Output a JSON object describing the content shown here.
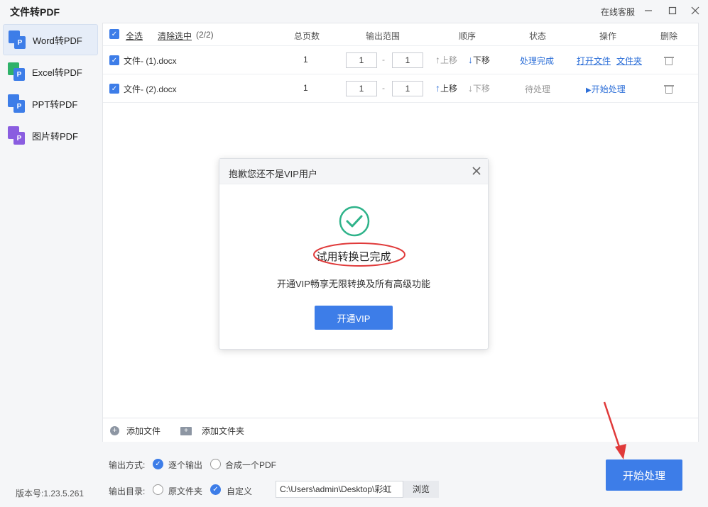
{
  "app": {
    "title": "文件转PDF",
    "online_service": "在线客服",
    "version": "版本号:1.23.5.261"
  },
  "sidebar": {
    "items": [
      {
        "label": "Word转PDF",
        "icon": "word-to-pdf-icon",
        "color": "#3d7de8",
        "active": true
      },
      {
        "label": "Excel转PDF",
        "icon": "excel-to-pdf-icon",
        "color": "#2fb26a",
        "active": false
      },
      {
        "label": "PPT转PDF",
        "icon": "ppt-to-pdf-icon",
        "color": "#3d7de8",
        "active": false
      },
      {
        "label": "图片转PDF",
        "icon": "image-to-pdf-icon",
        "color": "#8a5de0",
        "active": false
      }
    ]
  },
  "table": {
    "select_all": "全选",
    "clear_selection": "清除选中",
    "selected_count": "(2/2)",
    "headers": {
      "pages": "总页数",
      "range": "输出范围",
      "order": "顺序",
      "status": "状态",
      "action": "操作",
      "delete": "删除"
    },
    "range_sep": "-",
    "rows": [
      {
        "name": "文件- (1).docx",
        "pages": "1",
        "from": "1",
        "to": "1",
        "move_up": "上移",
        "move_down": "下移",
        "status": "处理完成",
        "open_file": "打开文件",
        "open_folder": "文件夹",
        "action": ""
      },
      {
        "name": "文件- (2).docx",
        "pages": "1",
        "from": "1",
        "to": "1",
        "move_up": "上移",
        "move_down": "下移",
        "status": "待处理",
        "open_file": "",
        "open_folder": "",
        "action": "开始处理"
      }
    ]
  },
  "footer": {
    "add_file": "添加文件",
    "add_folder": "添加文件夹"
  },
  "options": {
    "output_mode_label": "输出方式:",
    "mode_each": "逐个输出",
    "mode_merge": "合成一个PDF",
    "output_dir_label": "输出目录:",
    "dir_original": "原文件夹",
    "dir_custom": "自定义",
    "path": "C:\\Users\\admin\\Desktop\\彩虹",
    "browse": "浏览",
    "start": "开始处理"
  },
  "modal": {
    "title": "抱歉您还不是VIP用户",
    "message": "试用转换已完成",
    "sub": "开通VIP畅享无限转换及所有高级功能",
    "vip_button": "开通VIP"
  },
  "colors": {
    "accent": "#3d7de8",
    "success": "#2fb38a",
    "annotation": "#e03a3a"
  }
}
